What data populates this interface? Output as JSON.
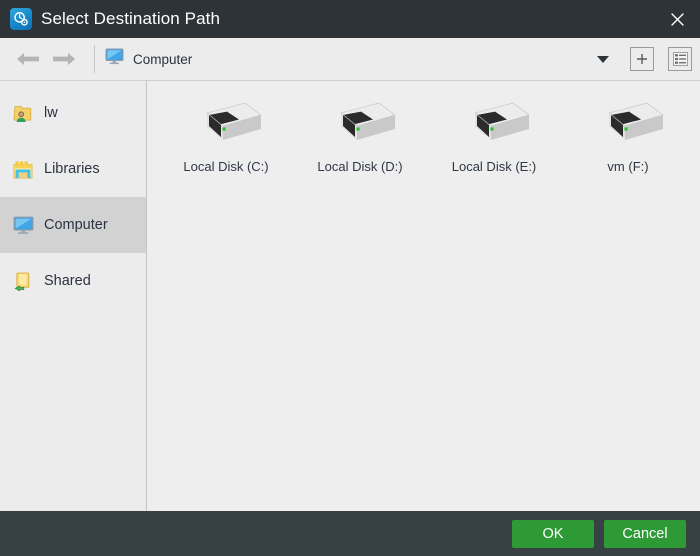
{
  "window": {
    "title": "Select Destination Path",
    "app_icon": "disk-clock-icon",
    "close_icon": "close-icon",
    "titlebar_color": "#2e3338",
    "footer_color": "#374043",
    "accent_color": "#2d9a35"
  },
  "toolbar": {
    "back_icon": "arrow-left-icon",
    "forward_icon": "arrow-right-icon",
    "location_icon": "computer-monitor-icon",
    "location_label": "Computer",
    "dropdown_icon": "chevron-down-icon",
    "new_folder_icon": "plus-icon",
    "view_mode_icon": "list-view-icon"
  },
  "sidebar": {
    "items": [
      {
        "label": "lw",
        "icon": "user-folder-icon",
        "selected": false
      },
      {
        "label": "Libraries",
        "icon": "libraries-icon",
        "selected": false
      },
      {
        "label": "Computer",
        "icon": "computer-monitor-icon",
        "selected": true
      },
      {
        "label": "Shared",
        "icon": "shared-folder-icon",
        "selected": false
      }
    ]
  },
  "content": {
    "items": [
      {
        "label": "Local Disk (C:)",
        "icon": "hard-disk-icon"
      },
      {
        "label": "Local Disk (D:)",
        "icon": "hard-disk-icon"
      },
      {
        "label": "Local Disk (E:)",
        "icon": "hard-disk-icon"
      },
      {
        "label": "vm (F:)",
        "icon": "hard-disk-icon"
      }
    ]
  },
  "footer": {
    "ok_label": "OK",
    "cancel_label": "Cancel"
  }
}
